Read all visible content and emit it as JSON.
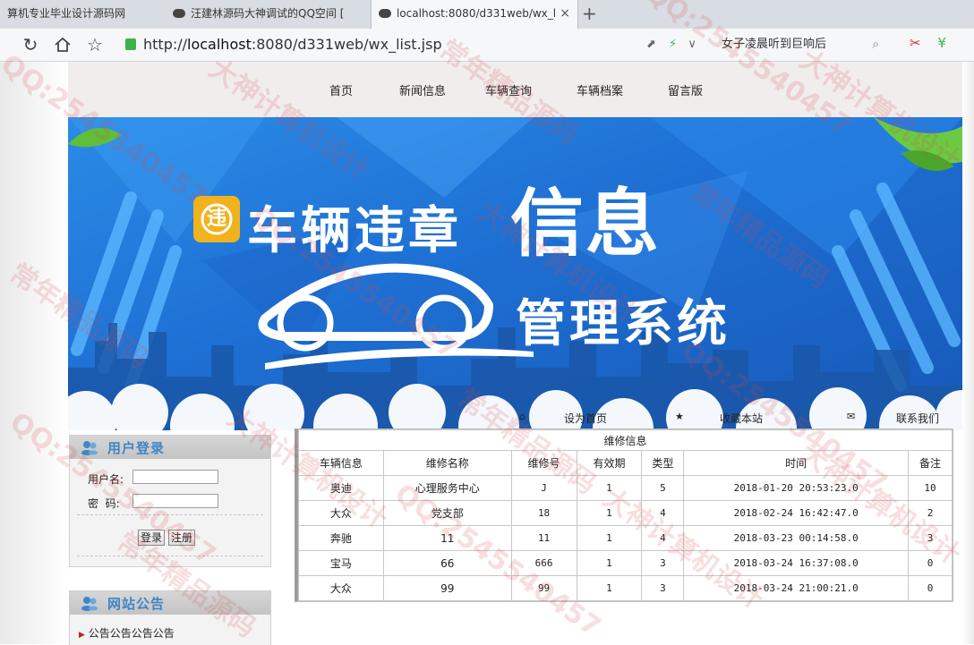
{
  "browser": {
    "tabs": [
      {
        "label": "算机专业毕业设计源码网"
      },
      {
        "label": "汪建林源码大神调试的QQ空间 [",
        "close": "×"
      },
      {
        "label": "localhost:8080/d331web/wx_l",
        "close": "×"
      }
    ],
    "new_tab": "+",
    "address": {
      "prefix": "http://",
      "host": "localhost",
      "rest": ":8080/d331web/wx_list.jsp"
    },
    "hint_text": "女子凌晨听到巨响后"
  },
  "nav": {
    "items": [
      {
        "label": "首页"
      },
      {
        "label": "新闻信息"
      },
      {
        "label": "车辆查询"
      },
      {
        "label": "车辆档案"
      },
      {
        "label": "留言版"
      }
    ]
  },
  "banner": {
    "badge": "违",
    "title_part1": "车辆违章",
    "title_part2": "信息",
    "title_part3": "管理系统"
  },
  "top_links": {
    "home": "设为首页",
    "fav": "收藏本站",
    "contact": "联系我们"
  },
  "login": {
    "title": "用户登录",
    "username_label": "用户名:",
    "password_label": "密  码:",
    "login_button": "登录",
    "register_button": "注册"
  },
  "notice": {
    "title": "网站公告",
    "item": "公告公告公告公告"
  },
  "table": {
    "caption": "维修信息",
    "headers": [
      "车辆信息",
      "维修名称",
      "维修号",
      "有效期",
      "类型",
      "时间",
      "备注"
    ],
    "rows": [
      [
        "奥迪",
        "心理服务中心",
        "J",
        "1",
        "5",
        "2018-01-20 20:53:23.0",
        "10"
      ],
      [
        "大众",
        "党支部",
        "18",
        "1",
        "4",
        "2018-02-24 16:42:47.0",
        "2"
      ],
      [
        "奔驰",
        "11",
        "11",
        "1",
        "4",
        "2018-03-23 00:14:58.0",
        "3"
      ],
      [
        "宝马",
        "66",
        "666",
        "1",
        "3",
        "2018-03-24 16:37:08.0",
        "0"
      ],
      [
        "大众",
        "99",
        "99",
        "1",
        "3",
        "2018-03-24 21:00:21.0",
        "0"
      ]
    ]
  },
  "watermark": {
    "lines": [
      "QQ:2545540457",
      "大神计算机设计",
      "常年精品源码"
    ]
  },
  "colors": {
    "banner_blue": "#1e6fd3",
    "accent": "#3f86c7",
    "badge": "#f2b21e"
  }
}
